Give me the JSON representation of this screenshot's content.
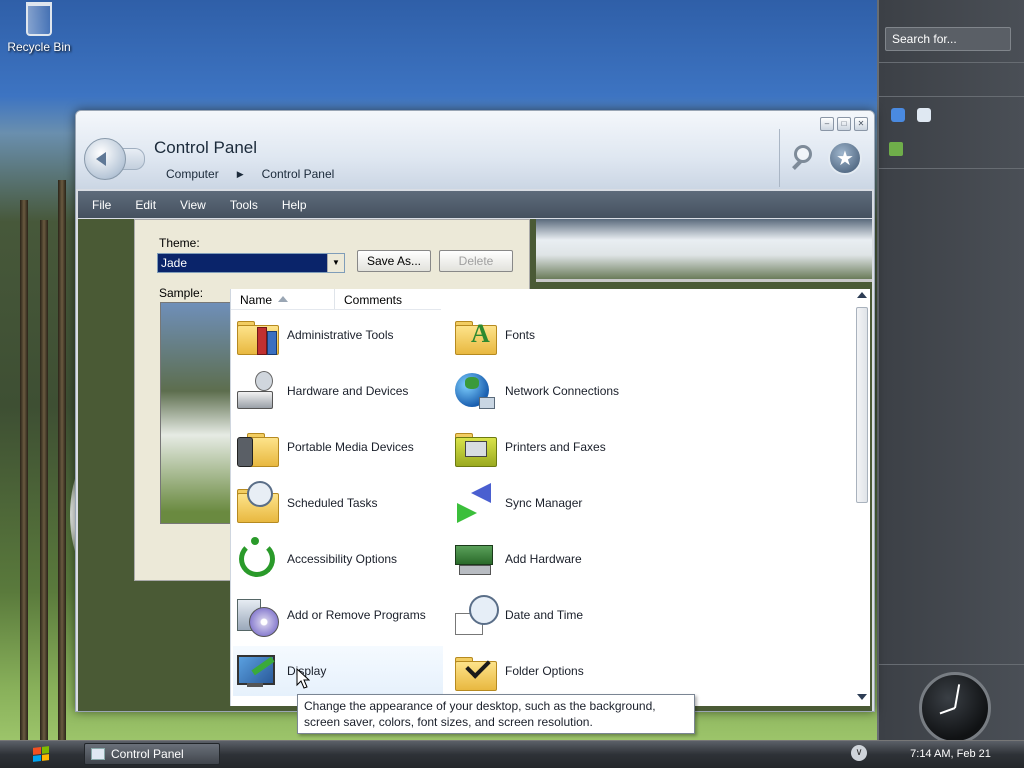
{
  "desktop": {
    "recycle_bin_label": "Recycle Bin"
  },
  "sidebar": {
    "search_placeholder": "Search for...",
    "clock_time": "7:14 AM, Feb 21"
  },
  "taskbar": {
    "task_label": "Control Panel"
  },
  "window": {
    "title": "Control Panel",
    "breadcrumb": [
      "Computer",
      "Control Panel"
    ],
    "menu": [
      "File",
      "Edit",
      "View",
      "Tools",
      "Help"
    ]
  },
  "dialog": {
    "theme_label": "Theme:",
    "theme_value": "Jade",
    "save_as_label": "Save As...",
    "delete_label": "Delete",
    "sample_label": "Sample:"
  },
  "list": {
    "columns": [
      "Name",
      "Comments"
    ],
    "items": [
      {
        "label": "Administrative Tools",
        "icon": "admin-tools-icon"
      },
      {
        "label": "Fonts",
        "icon": "fonts-icon"
      },
      {
        "label": "Hardware and Devices",
        "icon": "hardware-devices-icon"
      },
      {
        "label": "Network Connections",
        "icon": "network-connections-icon"
      },
      {
        "label": "Portable Media Devices",
        "icon": "portable-media-icon"
      },
      {
        "label": "Printers and Faxes",
        "icon": "printers-faxes-icon"
      },
      {
        "label": "Scheduled Tasks",
        "icon": "scheduled-tasks-icon"
      },
      {
        "label": "Sync Manager",
        "icon": "sync-manager-icon"
      },
      {
        "label": "Accessibility Options",
        "icon": "accessibility-icon"
      },
      {
        "label": "Add Hardware",
        "icon": "add-hardware-icon"
      },
      {
        "label": "Add or Remove Programs",
        "icon": "add-remove-programs-icon"
      },
      {
        "label": "Date and Time",
        "icon": "date-time-icon"
      },
      {
        "label": "Display",
        "icon": "display-icon"
      },
      {
        "label": "Folder Options",
        "icon": "folder-options-icon"
      }
    ]
  },
  "tooltip": {
    "text": "Change the appearance of your desktop, such as the background, screen saver, colors, font sizes, and screen resolution."
  },
  "colors": {
    "menubar": "#4f5c6b",
    "selection": "#0a246a",
    "sidebar": "#43474d"
  }
}
